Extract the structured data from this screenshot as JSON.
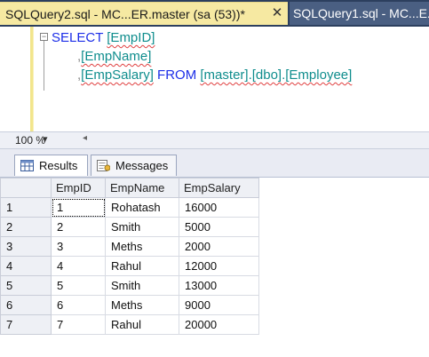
{
  "tabs": {
    "active": {
      "title": "SQLQuery2.sql - MC...ER.master (sa (53))*",
      "close": "✕"
    },
    "inactive": {
      "title": "SQLQuery1.sql - MC...E..."
    }
  },
  "editor": {
    "line1": {
      "keyword": "SELECT",
      "column": "[EmpID]"
    },
    "line2": {
      "comma": ",",
      "column": "[EmpName]"
    },
    "line3": {
      "comma": ",",
      "column": "[EmpSalary]",
      "keyword": "FROM",
      "table": "[master].[dbo].[Employee]"
    },
    "collapse_glyph": "−"
  },
  "zoom": {
    "value": "100 %",
    "dropdown": "▾",
    "scroll_left": "◂"
  },
  "results_tabs": {
    "results": "Results",
    "messages": "Messages"
  },
  "grid": {
    "headers": [
      "EmpID",
      "EmpName",
      "EmpSalary"
    ],
    "rows": [
      {
        "n": "1",
        "id": "1",
        "name": "Rohatash",
        "salary": "16000"
      },
      {
        "n": "2",
        "id": "2",
        "name": "Smith",
        "salary": "5000"
      },
      {
        "n": "3",
        "id": "3",
        "name": "Meths",
        "salary": "2000"
      },
      {
        "n": "4",
        "id": "4",
        "name": "Rahul",
        "salary": "12000"
      },
      {
        "n": "5",
        "id": "5",
        "name": "Smith",
        "salary": "13000"
      },
      {
        "n": "6",
        "id": "6",
        "name": "Meths",
        "salary": "9000"
      },
      {
        "n": "7",
        "id": "7",
        "name": "Rahul",
        "salary": "20000"
      }
    ]
  },
  "colors": {
    "tab_active": "#f6e9a2",
    "tab_strip": "#2c3f5e",
    "keyword": "#1c2ee8",
    "identifier": "#0f8d8d"
  }
}
